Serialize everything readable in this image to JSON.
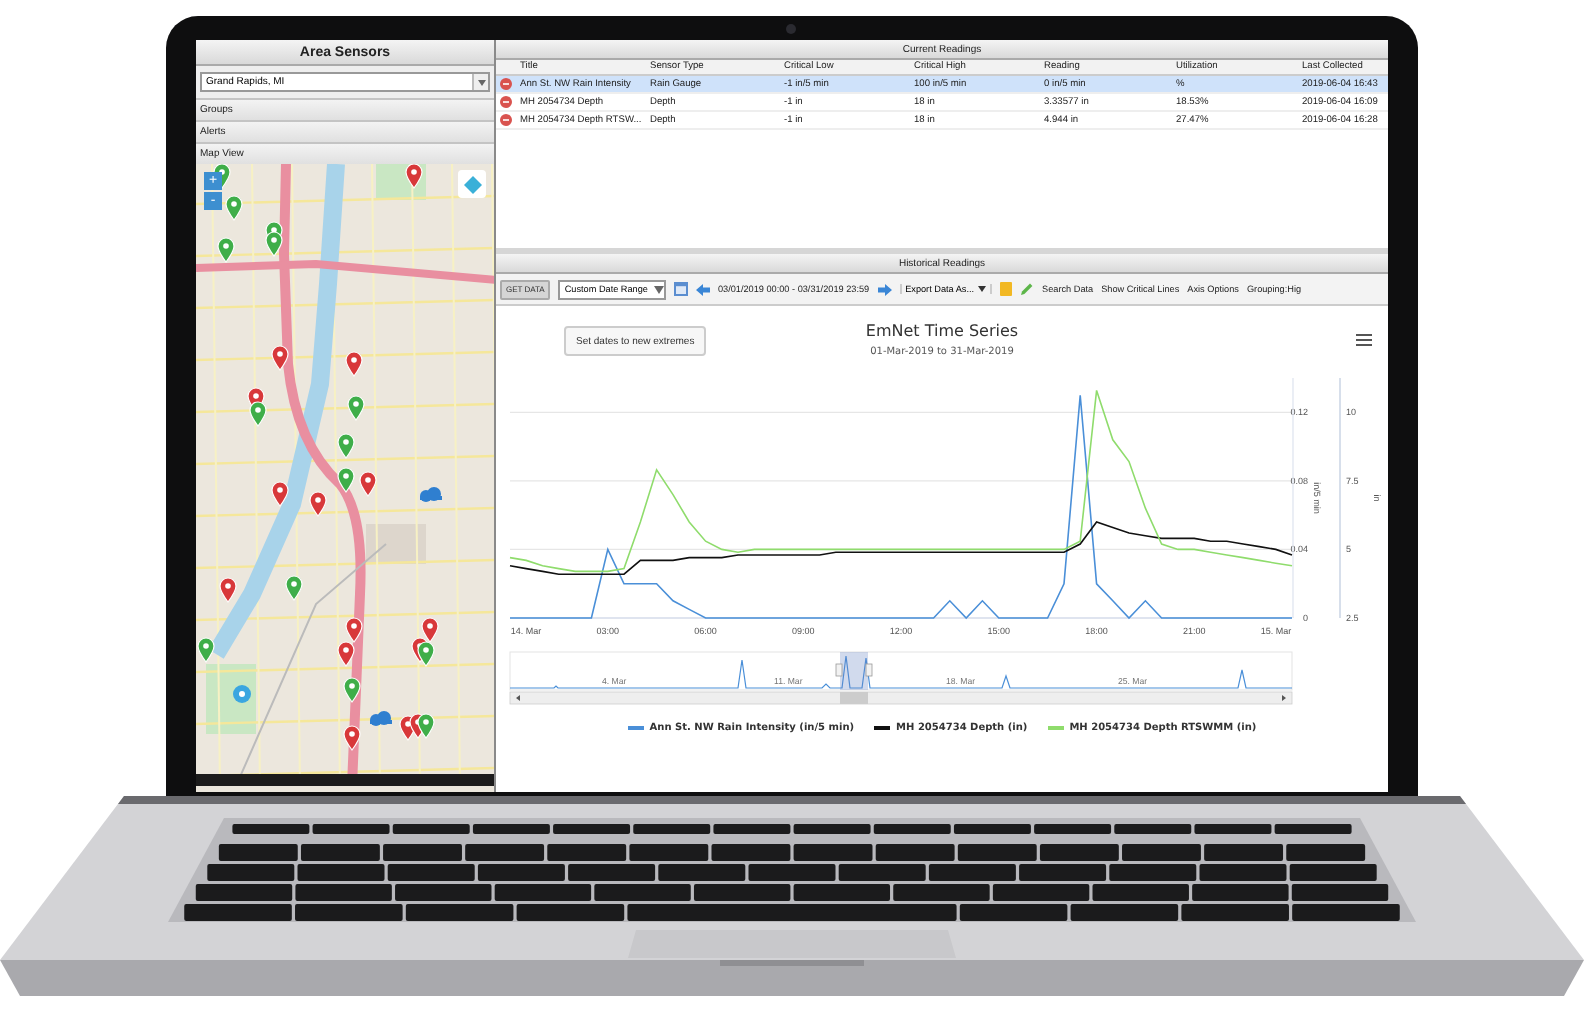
{
  "sidebar": {
    "title": "Area Sensors",
    "location": {
      "value": "Grand Rapids, MI"
    },
    "sections": [
      "Groups",
      "Alerts",
      "Map View"
    ],
    "map": {
      "zoom_controls": [
        "+",
        "-"
      ]
    }
  },
  "current_readings": {
    "title": "Current Readings",
    "columns": [
      "Title",
      "Sensor Type",
      "Critical Low",
      "Critical High",
      "Reading",
      "Utilization",
      "Last Collected"
    ],
    "rows": [
      {
        "selected": true,
        "cells": [
          "Ann St. NW Rain Intensity",
          "Rain Gauge",
          "-1 in/5 min",
          "100 in/5 min",
          "0 in/5 min",
          "%",
          "2019-06-04 16:43"
        ]
      },
      {
        "selected": false,
        "cells": [
          "MH 2054734 Depth",
          "Depth",
          "-1 in",
          "18 in",
          "3.33577 in",
          "18.53%",
          "2019-06-04 16:09"
        ]
      },
      {
        "selected": false,
        "cells": [
          "MH 2054734 Depth RTSW...",
          "Depth",
          "-1 in",
          "18 in",
          "4.944 in",
          "27.47%",
          "2019-06-04 16:28"
        ]
      }
    ]
  },
  "historical_readings": {
    "title": "Historical Readings",
    "toolbar": [
      {
        "kind": "button",
        "label": "GET DATA"
      },
      {
        "kind": "select",
        "value": "Custom Date Range"
      },
      {
        "kind": "calendar"
      },
      {
        "kind": "prev"
      },
      {
        "kind": "range",
        "label": "03/01/2019 00:00 - 03/31/2019 23:59"
      },
      {
        "kind": "next"
      },
      {
        "kind": "menu",
        "label": "Export Data As..."
      },
      {
        "kind": "notes"
      },
      {
        "kind": "edit"
      },
      {
        "kind": "link",
        "label": "Search Data"
      },
      {
        "kind": "link",
        "label": "Show Critical Lines"
      },
      {
        "kind": "link",
        "label": "Axis Options"
      },
      {
        "kind": "link",
        "label": "Grouping:Hig"
      }
    ],
    "reset_button": "Set dates to new extremes",
    "subtitle": "01-Mar-2019 to 31-Mar-2019",
    "chart_data": {
      "type": "line",
      "title": "EmNet Time Series",
      "ylabel": "in/5 min",
      "y2label": "in",
      "x": [
        0,
        0.5,
        1,
        1.5,
        2,
        2.5,
        3,
        3.5,
        4,
        4.5,
        5,
        5.5,
        6,
        6.5,
        7,
        7.5,
        8,
        8.5,
        9,
        9.5,
        10,
        10.5,
        11,
        11.5,
        12,
        12.5,
        13,
        13.5,
        14,
        14.5,
        15,
        15.5,
        16,
        16.5,
        17,
        17.5,
        18,
        18.5,
        19,
        19.5,
        20,
        20.5,
        21,
        21.5,
        22,
        22.5,
        23,
        23.5,
        24
      ],
      "xlim": [
        0,
        24
      ],
      "xticks": [
        {
          "value": 0,
          "label": "14. Mar"
        },
        {
          "value": 3,
          "label": "03:00"
        },
        {
          "value": 6,
          "label": "06:00"
        },
        {
          "value": 9,
          "label": "09:00"
        },
        {
          "value": 12,
          "label": "12:00"
        },
        {
          "value": 15,
          "label": "15:00"
        },
        {
          "value": 18,
          "label": "18:00"
        },
        {
          "value": 21,
          "label": "21:00"
        },
        {
          "value": 24,
          "label": "15. Mar"
        }
      ],
      "ylim": [
        0,
        0.14
      ],
      "grid": true,
      "yticks": [
        0,
        0.04,
        0.08,
        0.12
      ],
      "y2lim": [
        2.5,
        11.25
      ],
      "y2ticks": [
        2.5,
        5,
        7.5,
        10
      ],
      "series": [
        {
          "name": "Ann St. NW Rain Intensity (in/5 min)",
          "color": "#4a8fd8",
          "values": [
            0,
            0,
            0,
            0,
            0,
            0,
            0.04,
            0.02,
            0.02,
            0.02,
            0.01,
            0.005,
            0,
            0,
            0,
            0,
            0,
            0,
            0,
            0,
            0,
            0,
            0,
            0,
            0,
            0,
            0,
            0.01,
            0,
            0.01,
            0,
            0,
            0,
            0,
            0.02,
            0.13,
            0.02,
            0.01,
            0,
            0.01,
            0,
            0,
            0,
            0,
            0,
            0,
            0,
            0,
            0
          ]
        },
        {
          "name": "MH 2054734 Depth (in)",
          "color": "#111111",
          "axis": "y2",
          "values": [
            4.4,
            4.3,
            4.2,
            4.1,
            4.1,
            4.1,
            4.1,
            4.1,
            4.6,
            4.6,
            4.6,
            4.7,
            4.7,
            4.7,
            4.8,
            4.8,
            4.8,
            4.8,
            4.8,
            4.8,
            4.9,
            4.9,
            4.9,
            4.9,
            4.9,
            4.9,
            4.9,
            4.9,
            4.9,
            4.9,
            4.9,
            4.9,
            4.9,
            4.9,
            4.9,
            5.2,
            6.0,
            5.8,
            5.6,
            5.5,
            5.4,
            5.4,
            5.4,
            5.3,
            5.3,
            5.2,
            5.1,
            5.0,
            4.8
          ]
        },
        {
          "name": "MH 2054734 Depth RTSWMM (in)",
          "color": "#8fdc6c",
          "axis": "y2",
          "values": [
            4.7,
            4.6,
            4.4,
            4.3,
            4.2,
            4.2,
            4.2,
            4.3,
            6.0,
            7.9,
            7.0,
            6.0,
            5.3,
            5.0,
            4.9,
            5.0,
            5.0,
            5.0,
            5.0,
            5.0,
            5.0,
            5.0,
            5.0,
            5.0,
            5.0,
            5.0,
            5.0,
            5.0,
            5.0,
            5.0,
            5.0,
            5.0,
            5.0,
            5.0,
            5.0,
            5.3,
            10.8,
            9.0,
            8.2,
            6.5,
            5.2,
            5.0,
            5.0,
            4.9,
            4.8,
            4.7,
            4.6,
            4.5,
            4.4
          ]
        }
      ]
    },
    "navigator_labels": [
      "4. Mar",
      "11. Mar",
      "18. Mar",
      "25. Mar"
    ]
  }
}
